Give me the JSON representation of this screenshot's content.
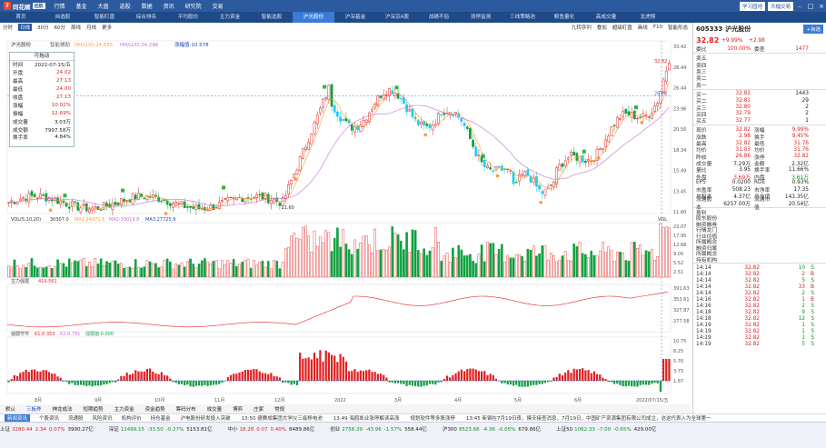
{
  "app": {
    "name": "同花顺",
    "tag": "远航",
    "menus": [
      "行情",
      "基金",
      "大盘",
      "选股",
      "数据",
      "资讯",
      "研究院",
      "交易"
    ],
    "right_buttons": [
      "学习园地",
      "大幅交易"
    ]
  },
  "nav_tabs": [
    "首页",
    "自选股",
    "智能盯盘",
    "综合排名",
    "平均股价",
    "主力资金",
    "智能选股",
    "沪光股份",
    "沪深基金",
    "沪深京A股",
    "战绩不俗",
    "涨停监测",
    "三线策略池",
    "鲸鱼量化",
    "高成交量",
    "龙虎榜"
  ],
  "nav_active": 7,
  "toolbar": {
    "items": [
      "分时",
      "日线",
      "30分",
      "60分",
      "周线",
      "月线",
      "更多"
    ],
    "active": 1,
    "right_items": [
      "九转序列",
      "叠加",
      "超级盯盘",
      "画线",
      "F10",
      "智能形态"
    ]
  },
  "stock": {
    "code": "605333",
    "name": "沪光股份",
    "price": "32.82",
    "change_pct": "+9.99%",
    "change": "+2.98",
    "committee_ratio": "100.00%",
    "committee_diff": "1477"
  },
  "chart_labels": {
    "ma_line": "沪光股份",
    "indicator": "智能辅助",
    "hhlu": "HH/LUD:24.535",
    "hhlu2": "HH/LUD:24.296",
    "gain": "涨幅值:10.578",
    "vol_title": "VOL(5,10,20)",
    "vol_val": "30307.0",
    "ma1": "MA1:24971.6",
    "ma2": "MA2:33019.8",
    "ma3": "MA3:27725.9",
    "main_flow": "主力强弱",
    "main_flow_val": "419.561",
    "kdj_title": "强弱节节",
    "k1": "K1:0.353",
    "k2": "K2:0.791",
    "k3": "强弱值:0.000",
    "max_price": "32.82",
    "min_price": "11.60",
    "cur_line": "26.66",
    "vol_right": "VOL"
  },
  "price_axis": [
    "33.42",
    "28.44",
    "26.44",
    "23.96",
    "20.56",
    "18.34",
    "15.49",
    "13.45",
    "11.60"
  ],
  "vol_axis": [
    "22.07",
    "17.95",
    "12.68",
    "9.00",
    "5.52",
    "2.51"
  ],
  "flow_axis": [
    "391.63",
    "353.61",
    "327.87",
    "277.58"
  ],
  "kdj_axis": [
    "10.75",
    "8.25",
    "5.76",
    "3.75",
    "1.87"
  ],
  "months": [
    "8月",
    "9月",
    "10月",
    "11月",
    "12月",
    "2022",
    "3月",
    "4月",
    "5月",
    "6月",
    "2022/07/15/五"
  ],
  "info_box": {
    "title": "可拖动",
    "rows": [
      [
        "时间",
        "2022-07-15/五"
      ],
      [
        "开盘",
        "24.02"
      ],
      [
        "最高",
        "27.13"
      ],
      [
        "最低",
        "24.00"
      ],
      [
        "收盘",
        "27.13"
      ],
      [
        "涨幅",
        "10.02%"
      ],
      [
        "振幅",
        "12.69%"
      ],
      [
        "成交量",
        "3.03万"
      ],
      [
        "成交额",
        "7997.58万"
      ],
      [
        "换手率",
        "4.84%"
      ]
    ]
  },
  "order_book": {
    "sell": [
      [
        "卖五",
        "",
        ""
      ],
      [
        "卖四",
        "",
        ""
      ],
      [
        "卖三",
        "",
        ""
      ],
      [
        "卖二",
        "",
        ""
      ],
      [
        "卖一",
        "",
        ""
      ]
    ],
    "buy": [
      [
        "买一",
        "32.82",
        "1443"
      ],
      [
        "买二",
        "32.81",
        "29"
      ],
      [
        "买三",
        "32.80",
        "2"
      ],
      [
        "买四",
        "32.79",
        "2"
      ],
      [
        "买五",
        "32.77",
        "1"
      ]
    ]
  },
  "stats": [
    [
      "现价",
      "32.82",
      "涨幅",
      "9.99%"
    ],
    [
      "涨跌",
      "2.98",
      "换手",
      "9.45%"
    ],
    [
      "最高",
      "32.82",
      "最低",
      "31.76"
    ],
    [
      "均价",
      "31.03",
      "均价",
      "31.76"
    ],
    [
      "昨收",
      "26.86",
      "涨停",
      "32.82"
    ],
    [
      "成交量",
      "7.29万",
      "金额",
      "2.32亿"
    ],
    [
      "量比",
      "3.95",
      "换手率",
      "11.66%"
    ],
    [
      "外盘",
      "3.69万",
      "内盘",
      "3.61万"
    ],
    [
      "EPS",
      "0.0200",
      "RDE",
      "0.93%"
    ],
    [
      "市盈率",
      "508.23",
      "市净率",
      "17.35"
    ],
    [
      "总股本",
      "4.37亿",
      "总市值",
      "143.35亿"
    ],
    [
      "流通股本",
      "6257.00万",
      "流通市值",
      "20.54亿"
    ]
  ],
  "misc_rows": [
    "盈利",
    "股东股份",
    "融资融券",
    "行情龙门",
    "行业估值",
    "所属概念",
    "融资归属",
    "所属概念",
    "持有机构"
  ],
  "ticks": [
    [
      "14:14",
      "32.82",
      "10",
      "S"
    ],
    [
      "14:14",
      "32.82",
      "2",
      "B"
    ],
    [
      "14:14",
      "32.82",
      "5",
      "S"
    ],
    [
      "14:14",
      "32.82",
      "33",
      "B"
    ],
    [
      "14:14",
      "32.82",
      "2",
      "S"
    ],
    [
      "14:16",
      "32.82",
      "1",
      "B"
    ],
    [
      "14:16",
      "32.82",
      "2",
      "S"
    ],
    [
      "14:18",
      "32.82",
      "9",
      "S"
    ],
    [
      "14:18",
      "32.82",
      "12",
      "S"
    ],
    [
      "14:19",
      "32.82",
      "1",
      "S"
    ],
    [
      "14:19",
      "32.82",
      "1",
      "S"
    ],
    [
      "14:19",
      "32.82",
      "1",
      "S"
    ],
    [
      "14:19",
      "32.82",
      "5",
      "S"
    ]
  ],
  "bottom_tabs": [
    "默认",
    "三板斧",
    "神龙成法",
    "短期趋势",
    "主力资金",
    "资金趋势",
    "筹码分布",
    "成交量",
    "博弈",
    "庄家",
    "常规"
  ],
  "news": {
    "tabs": [
      "新闻资讯",
      "个股资讯",
      "流通股",
      "风险资讯",
      "机构评价",
      "持仓基金"
    ],
    "items": [
      "沪电股份研发投入突破",
      "13:50 德赛成集团大学仪三级移电池",
      "13:49 海鸥凯业涨停解读高涨",
      "规划软件等多股涨停",
      "13:45 新钢在7月19日夜，摸天接查消息，7月19日，中国矿产资源集团有限公司成立，这这代表入为全球第一"
    ]
  },
  "index_bar": [
    [
      "上证",
      "3280.44",
      "2.34",
      "0.07%",
      "3990.27亿"
    ],
    [
      "深证",
      "12499.15",
      "-33.50",
      "-0.27%",
      "5153.81亿"
    ],
    [
      "中小",
      "18.28",
      "0.07",
      "0.40%",
      "8489.86亿"
    ],
    [
      "创业",
      "2756.39",
      "-43.96",
      "-1.57%",
      "558.44亿"
    ],
    [
      "沪300",
      "8523.66",
      "-4.36",
      "-0.05%",
      "679.86亿"
    ],
    [
      "上证50",
      "1062.33",
      "-7.00",
      "-0.65%",
      "429.00亿"
    ]
  ],
  "side_right": [
    "成交",
    "明细",
    "资金",
    "要闻",
    "同行"
  ],
  "colors": {
    "up": "#e02020",
    "down": "#10a040",
    "flat_up": "#22ccee",
    "ma_orange": "#ff9a30",
    "ma_purple": "#c070d0",
    "brand": "#2b5a9e"
  }
}
